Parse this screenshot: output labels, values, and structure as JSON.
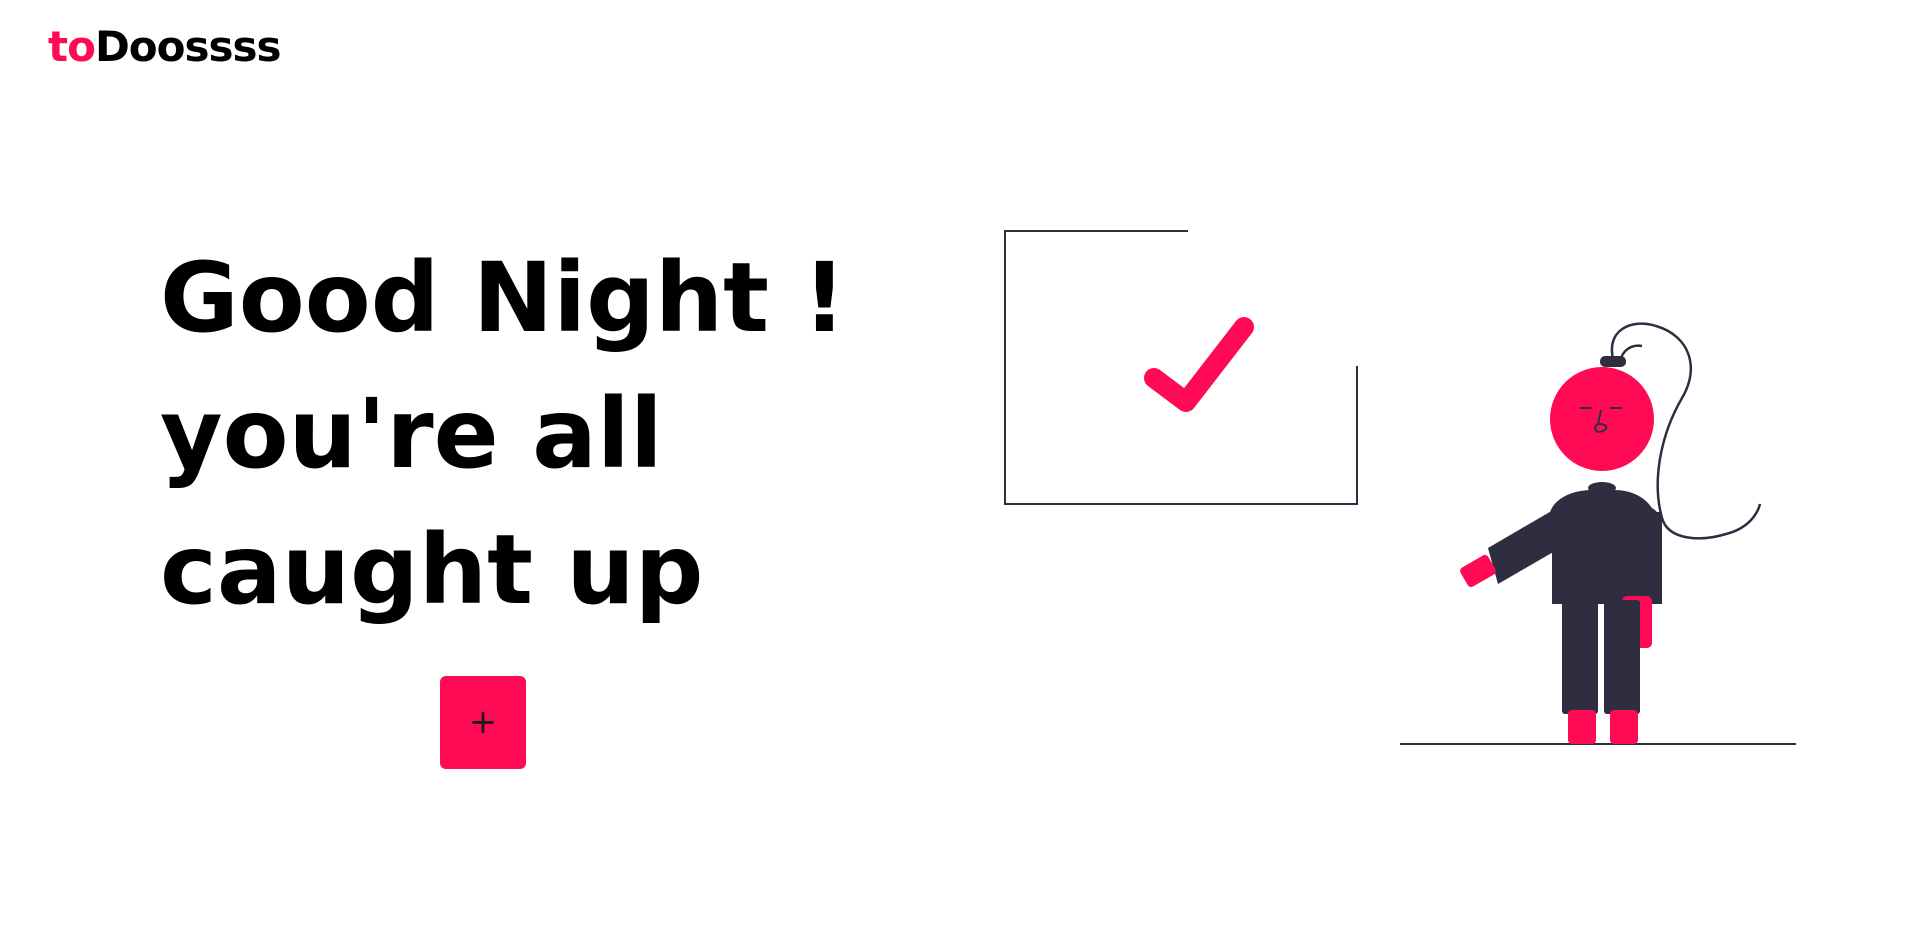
{
  "brand": {
    "prefix": "to",
    "suffix": "Doossss",
    "accent_color": "#ff0a54"
  },
  "greeting": {
    "line1": "Good Night !",
    "line2": "you're all",
    "line3": "caught up"
  },
  "add_button": {
    "label": "+",
    "icon": "plus-icon"
  },
  "illustration": {
    "description_icon": "completed-tasks-illustration",
    "primary_color": "#ff0a54",
    "dark_color": "#2f2e41"
  }
}
